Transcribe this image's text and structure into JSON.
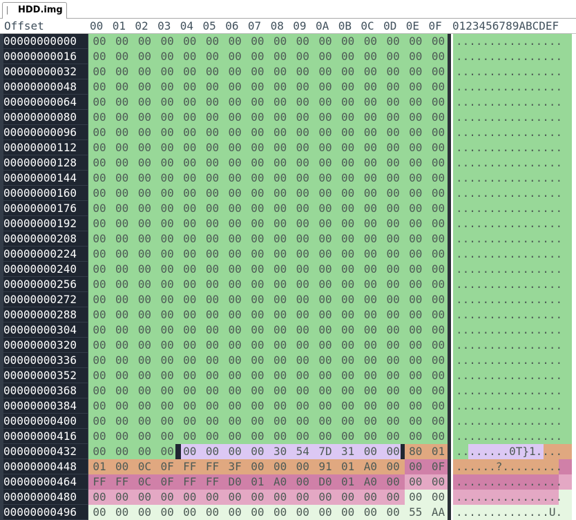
{
  "tab": {
    "label": "HDD.img"
  },
  "header": {
    "offset_label": "Offset",
    "columns": [
      "00",
      "01",
      "02",
      "03",
      "04",
      "05",
      "06",
      "07",
      "08",
      "09",
      "0A",
      "0B",
      "0C",
      "0D",
      "0E",
      "0F"
    ],
    "ascii_label": "0123456789ABCDEF"
  },
  "colors": {
    "green": "#98d898",
    "lavender": "#dcc8f4",
    "orange": "#e0a880",
    "magenta": "#d080a8",
    "pink": "#e4a8c4",
    "cursor": "#1f2631",
    "pale": "#e6f6e2"
  },
  "rows": [
    {
      "offset": "00000000000",
      "bytes": [
        "00",
        "00",
        "00",
        "00",
        "00",
        "00",
        "00",
        "00",
        "00",
        "00",
        "00",
        "00",
        "00",
        "00",
        "00",
        "00"
      ],
      "ascii": "................",
      "segments": [
        {
          "from": 0,
          "to": 16,
          "color": "green"
        }
      ]
    },
    {
      "offset": "00000000016",
      "bytes": [
        "00",
        "00",
        "00",
        "00",
        "00",
        "00",
        "00",
        "00",
        "00",
        "00",
        "00",
        "00",
        "00",
        "00",
        "00",
        "00"
      ],
      "ascii": "................",
      "segments": [
        {
          "from": 0,
          "to": 16,
          "color": "green"
        }
      ]
    },
    {
      "offset": "00000000032",
      "bytes": [
        "00",
        "00",
        "00",
        "00",
        "00",
        "00",
        "00",
        "00",
        "00",
        "00",
        "00",
        "00",
        "00",
        "00",
        "00",
        "00"
      ],
      "ascii": "................",
      "segments": [
        {
          "from": 0,
          "to": 16,
          "color": "green"
        }
      ]
    },
    {
      "offset": "00000000048",
      "bytes": [
        "00",
        "00",
        "00",
        "00",
        "00",
        "00",
        "00",
        "00",
        "00",
        "00",
        "00",
        "00",
        "00",
        "00",
        "00",
        "00"
      ],
      "ascii": "................",
      "segments": [
        {
          "from": 0,
          "to": 16,
          "color": "green"
        }
      ]
    },
    {
      "offset": "00000000064",
      "bytes": [
        "00",
        "00",
        "00",
        "00",
        "00",
        "00",
        "00",
        "00",
        "00",
        "00",
        "00",
        "00",
        "00",
        "00",
        "00",
        "00"
      ],
      "ascii": "................",
      "segments": [
        {
          "from": 0,
          "to": 16,
          "color": "green"
        }
      ]
    },
    {
      "offset": "00000000080",
      "bytes": [
        "00",
        "00",
        "00",
        "00",
        "00",
        "00",
        "00",
        "00",
        "00",
        "00",
        "00",
        "00",
        "00",
        "00",
        "00",
        "00"
      ],
      "ascii": "................",
      "segments": [
        {
          "from": 0,
          "to": 16,
          "color": "green"
        }
      ]
    },
    {
      "offset": "00000000096",
      "bytes": [
        "00",
        "00",
        "00",
        "00",
        "00",
        "00",
        "00",
        "00",
        "00",
        "00",
        "00",
        "00",
        "00",
        "00",
        "00",
        "00"
      ],
      "ascii": "................",
      "segments": [
        {
          "from": 0,
          "to": 16,
          "color": "green"
        }
      ]
    },
    {
      "offset": "00000000112",
      "bytes": [
        "00",
        "00",
        "00",
        "00",
        "00",
        "00",
        "00",
        "00",
        "00",
        "00",
        "00",
        "00",
        "00",
        "00",
        "00",
        "00"
      ],
      "ascii": "................",
      "segments": [
        {
          "from": 0,
          "to": 16,
          "color": "green"
        }
      ]
    },
    {
      "offset": "00000000128",
      "bytes": [
        "00",
        "00",
        "00",
        "00",
        "00",
        "00",
        "00",
        "00",
        "00",
        "00",
        "00",
        "00",
        "00",
        "00",
        "00",
        "00"
      ],
      "ascii": "................",
      "segments": [
        {
          "from": 0,
          "to": 16,
          "color": "green"
        }
      ]
    },
    {
      "offset": "00000000144",
      "bytes": [
        "00",
        "00",
        "00",
        "00",
        "00",
        "00",
        "00",
        "00",
        "00",
        "00",
        "00",
        "00",
        "00",
        "00",
        "00",
        "00"
      ],
      "ascii": "................",
      "segments": [
        {
          "from": 0,
          "to": 16,
          "color": "green"
        }
      ]
    },
    {
      "offset": "00000000160",
      "bytes": [
        "00",
        "00",
        "00",
        "00",
        "00",
        "00",
        "00",
        "00",
        "00",
        "00",
        "00",
        "00",
        "00",
        "00",
        "00",
        "00"
      ],
      "ascii": "................",
      "segments": [
        {
          "from": 0,
          "to": 16,
          "color": "green"
        }
      ]
    },
    {
      "offset": "00000000176",
      "bytes": [
        "00",
        "00",
        "00",
        "00",
        "00",
        "00",
        "00",
        "00",
        "00",
        "00",
        "00",
        "00",
        "00",
        "00",
        "00",
        "00"
      ],
      "ascii": "................",
      "segments": [
        {
          "from": 0,
          "to": 16,
          "color": "green"
        }
      ]
    },
    {
      "offset": "00000000192",
      "bytes": [
        "00",
        "00",
        "00",
        "00",
        "00",
        "00",
        "00",
        "00",
        "00",
        "00",
        "00",
        "00",
        "00",
        "00",
        "00",
        "00"
      ],
      "ascii": "................",
      "segments": [
        {
          "from": 0,
          "to": 16,
          "color": "green"
        }
      ]
    },
    {
      "offset": "00000000208",
      "bytes": [
        "00",
        "00",
        "00",
        "00",
        "00",
        "00",
        "00",
        "00",
        "00",
        "00",
        "00",
        "00",
        "00",
        "00",
        "00",
        "00"
      ],
      "ascii": "................",
      "segments": [
        {
          "from": 0,
          "to": 16,
          "color": "green"
        }
      ]
    },
    {
      "offset": "00000000224",
      "bytes": [
        "00",
        "00",
        "00",
        "00",
        "00",
        "00",
        "00",
        "00",
        "00",
        "00",
        "00",
        "00",
        "00",
        "00",
        "00",
        "00"
      ],
      "ascii": "................",
      "segments": [
        {
          "from": 0,
          "to": 16,
          "color": "green"
        }
      ]
    },
    {
      "offset": "00000000240",
      "bytes": [
        "00",
        "00",
        "00",
        "00",
        "00",
        "00",
        "00",
        "00",
        "00",
        "00",
        "00",
        "00",
        "00",
        "00",
        "00",
        "00"
      ],
      "ascii": "................",
      "segments": [
        {
          "from": 0,
          "to": 16,
          "color": "green"
        }
      ]
    },
    {
      "offset": "00000000256",
      "bytes": [
        "00",
        "00",
        "00",
        "00",
        "00",
        "00",
        "00",
        "00",
        "00",
        "00",
        "00",
        "00",
        "00",
        "00",
        "00",
        "00"
      ],
      "ascii": "................",
      "segments": [
        {
          "from": 0,
          "to": 16,
          "color": "green"
        }
      ]
    },
    {
      "offset": "00000000272",
      "bytes": [
        "00",
        "00",
        "00",
        "00",
        "00",
        "00",
        "00",
        "00",
        "00",
        "00",
        "00",
        "00",
        "00",
        "00",
        "00",
        "00"
      ],
      "ascii": "................",
      "segments": [
        {
          "from": 0,
          "to": 16,
          "color": "green"
        }
      ]
    },
    {
      "offset": "00000000288",
      "bytes": [
        "00",
        "00",
        "00",
        "00",
        "00",
        "00",
        "00",
        "00",
        "00",
        "00",
        "00",
        "00",
        "00",
        "00",
        "00",
        "00"
      ],
      "ascii": "................",
      "segments": [
        {
          "from": 0,
          "to": 16,
          "color": "green"
        }
      ]
    },
    {
      "offset": "00000000304",
      "bytes": [
        "00",
        "00",
        "00",
        "00",
        "00",
        "00",
        "00",
        "00",
        "00",
        "00",
        "00",
        "00",
        "00",
        "00",
        "00",
        "00"
      ],
      "ascii": "................",
      "segments": [
        {
          "from": 0,
          "to": 16,
          "color": "green"
        }
      ]
    },
    {
      "offset": "00000000320",
      "bytes": [
        "00",
        "00",
        "00",
        "00",
        "00",
        "00",
        "00",
        "00",
        "00",
        "00",
        "00",
        "00",
        "00",
        "00",
        "00",
        "00"
      ],
      "ascii": "................",
      "segments": [
        {
          "from": 0,
          "to": 16,
          "color": "green"
        }
      ]
    },
    {
      "offset": "00000000336",
      "bytes": [
        "00",
        "00",
        "00",
        "00",
        "00",
        "00",
        "00",
        "00",
        "00",
        "00",
        "00",
        "00",
        "00",
        "00",
        "00",
        "00"
      ],
      "ascii": "................",
      "segments": [
        {
          "from": 0,
          "to": 16,
          "color": "green"
        }
      ]
    },
    {
      "offset": "00000000352",
      "bytes": [
        "00",
        "00",
        "00",
        "00",
        "00",
        "00",
        "00",
        "00",
        "00",
        "00",
        "00",
        "00",
        "00",
        "00",
        "00",
        "00"
      ],
      "ascii": "................",
      "segments": [
        {
          "from": 0,
          "to": 16,
          "color": "green"
        }
      ]
    },
    {
      "offset": "00000000368",
      "bytes": [
        "00",
        "00",
        "00",
        "00",
        "00",
        "00",
        "00",
        "00",
        "00",
        "00",
        "00",
        "00",
        "00",
        "00",
        "00",
        "00"
      ],
      "ascii": "................",
      "segments": [
        {
          "from": 0,
          "to": 16,
          "color": "green"
        }
      ]
    },
    {
      "offset": "00000000384",
      "bytes": [
        "00",
        "00",
        "00",
        "00",
        "00",
        "00",
        "00",
        "00",
        "00",
        "00",
        "00",
        "00",
        "00",
        "00",
        "00",
        "00"
      ],
      "ascii": "................",
      "segments": [
        {
          "from": 0,
          "to": 16,
          "color": "green"
        }
      ]
    },
    {
      "offset": "00000000400",
      "bytes": [
        "00",
        "00",
        "00",
        "00",
        "00",
        "00",
        "00",
        "00",
        "00",
        "00",
        "00",
        "00",
        "00",
        "00",
        "00",
        "00"
      ],
      "ascii": "................",
      "segments": [
        {
          "from": 0,
          "to": 16,
          "color": "green"
        }
      ]
    },
    {
      "offset": "00000000416",
      "bytes": [
        "00",
        "00",
        "00",
        "00",
        "00",
        "00",
        "00",
        "00",
        "00",
        "00",
        "00",
        "00",
        "00",
        "00",
        "00",
        "00"
      ],
      "ascii": "................",
      "segments": [
        {
          "from": 0,
          "to": 16,
          "color": "green"
        }
      ]
    },
    {
      "offset": "00000000432",
      "bytes": [
        "00",
        "00",
        "00",
        "00",
        "00",
        "00",
        "00",
        "00",
        "30",
        "54",
        "7D",
        "31",
        "00",
        "00",
        "80",
        "01"
      ],
      "ascii": "....    ....0T}1..",
      "asciiText": "........0T}1....",
      "segments": [
        {
          "from": 0,
          "to": 4,
          "color": "green"
        },
        {
          "from": 4,
          "to": 14,
          "color": "lavender"
        },
        {
          "from": 14,
          "to": 16,
          "color": "orange"
        }
      ],
      "asciiSegments": [
        {
          "from": 0,
          "to": 2,
          "color": "green"
        },
        {
          "from": 2,
          "to": 12,
          "color": "lavender"
        },
        {
          "from": 12,
          "to": 16,
          "color": "orange"
        }
      ],
      "cursorAfter": 3
    },
    {
      "offset": "00000000448",
      "bytes": [
        "01",
        "00",
        "0C",
        "0F",
        "FF",
        "FF",
        "3F",
        "00",
        "00",
        "00",
        "91",
        "01",
        "A0",
        "00",
        "00",
        "0F"
      ],
      "ascii": "......?.........",
      "segments": [
        {
          "from": 0,
          "to": 14,
          "color": "orange"
        },
        {
          "from": 14,
          "to": 16,
          "color": "magenta"
        }
      ],
      "asciiSegments": [
        {
          "from": 0,
          "to": 14,
          "color": "orange"
        },
        {
          "from": 14,
          "to": 16,
          "color": "magenta"
        }
      ]
    },
    {
      "offset": "00000000464",
      "bytes": [
        "FF",
        "FF",
        "0C",
        "0F",
        "FF",
        "FF",
        "D0",
        "01",
        "A0",
        "00",
        "D0",
        "01",
        "A0",
        "00",
        "00",
        "00"
      ],
      "ascii": "................",
      "segments": [
        {
          "from": 0,
          "to": 14,
          "color": "magenta"
        },
        {
          "from": 14,
          "to": 16,
          "color": "pink"
        }
      ],
      "asciiSegments": [
        {
          "from": 0,
          "to": 14,
          "color": "magenta"
        },
        {
          "from": 14,
          "to": 16,
          "color": "pink"
        }
      ]
    },
    {
      "offset": "00000000480",
      "bytes": [
        "00",
        "00",
        "00",
        "00",
        "00",
        "00",
        "00",
        "00",
        "00",
        "00",
        "00",
        "00",
        "00",
        "00",
        "00",
        "00"
      ],
      "ascii": "................",
      "segments": [
        {
          "from": 0,
          "to": 14,
          "color": "pink"
        },
        {
          "from": 14,
          "to": 16,
          "color": "pale"
        }
      ],
      "asciiSegments": [
        {
          "from": 0,
          "to": 14,
          "color": "pink"
        },
        {
          "from": 14,
          "to": 16,
          "color": "pale"
        }
      ]
    },
    {
      "offset": "00000000496",
      "bytes": [
        "00",
        "00",
        "00",
        "00",
        "00",
        "00",
        "00",
        "00",
        "00",
        "00",
        "00",
        "00",
        "00",
        "00",
        "55",
        "AA"
      ],
      "ascii": "..............U.",
      "segments": [
        {
          "from": 0,
          "to": 14,
          "color": "pale"
        },
        {
          "from": 14,
          "to": 16,
          "color": "pale"
        }
      ],
      "asciiSegments": [
        {
          "from": 0,
          "to": 14,
          "color": "pale"
        },
        {
          "from": 14,
          "to": 16,
          "color": "pale"
        }
      ]
    }
  ]
}
